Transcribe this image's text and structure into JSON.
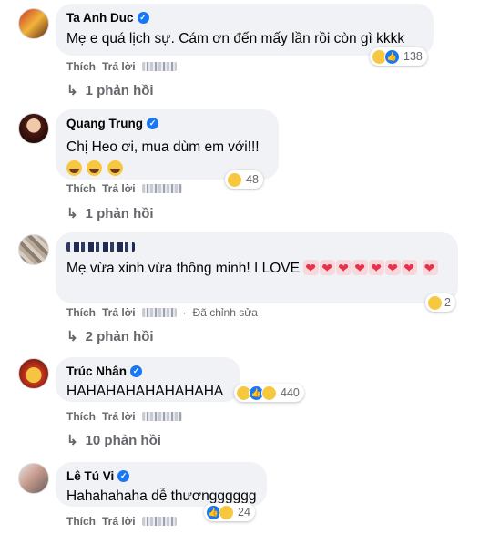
{
  "actions": {
    "like": "Thích",
    "reply": "Trả lời",
    "edited": "Đã chỉnh sửa"
  },
  "comments": [
    {
      "name": "Ta Anh Duc",
      "text": "Mẹ e quá lịch sự. Cám ơn đến mấy lần rồi còn gì kkkk",
      "reaction_count": "138",
      "reaction_icons": [
        "haha-icon",
        "like-icon"
      ],
      "replies": "1 phản hồi"
    },
    {
      "name": "Quang Trung",
      "text": "Chị Heo ơi, mua dùm em với!!!",
      "reaction_count": "48",
      "reaction_icons": [
        "haha-icon"
      ],
      "replies": "1 phản hồi"
    },
    {
      "name": "",
      "text": "Mẹ vừa xinh vừa thông minh! I LOVE",
      "reaction_count": "2",
      "reaction_icons": [
        "haha-icon"
      ],
      "replies": "2 phản hồi"
    },
    {
      "name": "Trúc Nhân",
      "text": "HAHAHAHAHAHAHAHA",
      "reaction_count": "440",
      "reaction_icons": [
        "haha-icon",
        "like-icon",
        "sad-icon"
      ],
      "replies": "10 phản hồi"
    },
    {
      "name": "Lê Tú Vi",
      "text": "Hahahahaha dễ thươngggggg",
      "reaction_count": "24",
      "reaction_icons": [
        "like-icon",
        "haha-icon"
      ],
      "replies": ""
    }
  ],
  "colors": {
    "bubble": "#f0f2f5",
    "meta": "#65676b",
    "verified": "#1877f2",
    "haha": "#f7c83f"
  }
}
